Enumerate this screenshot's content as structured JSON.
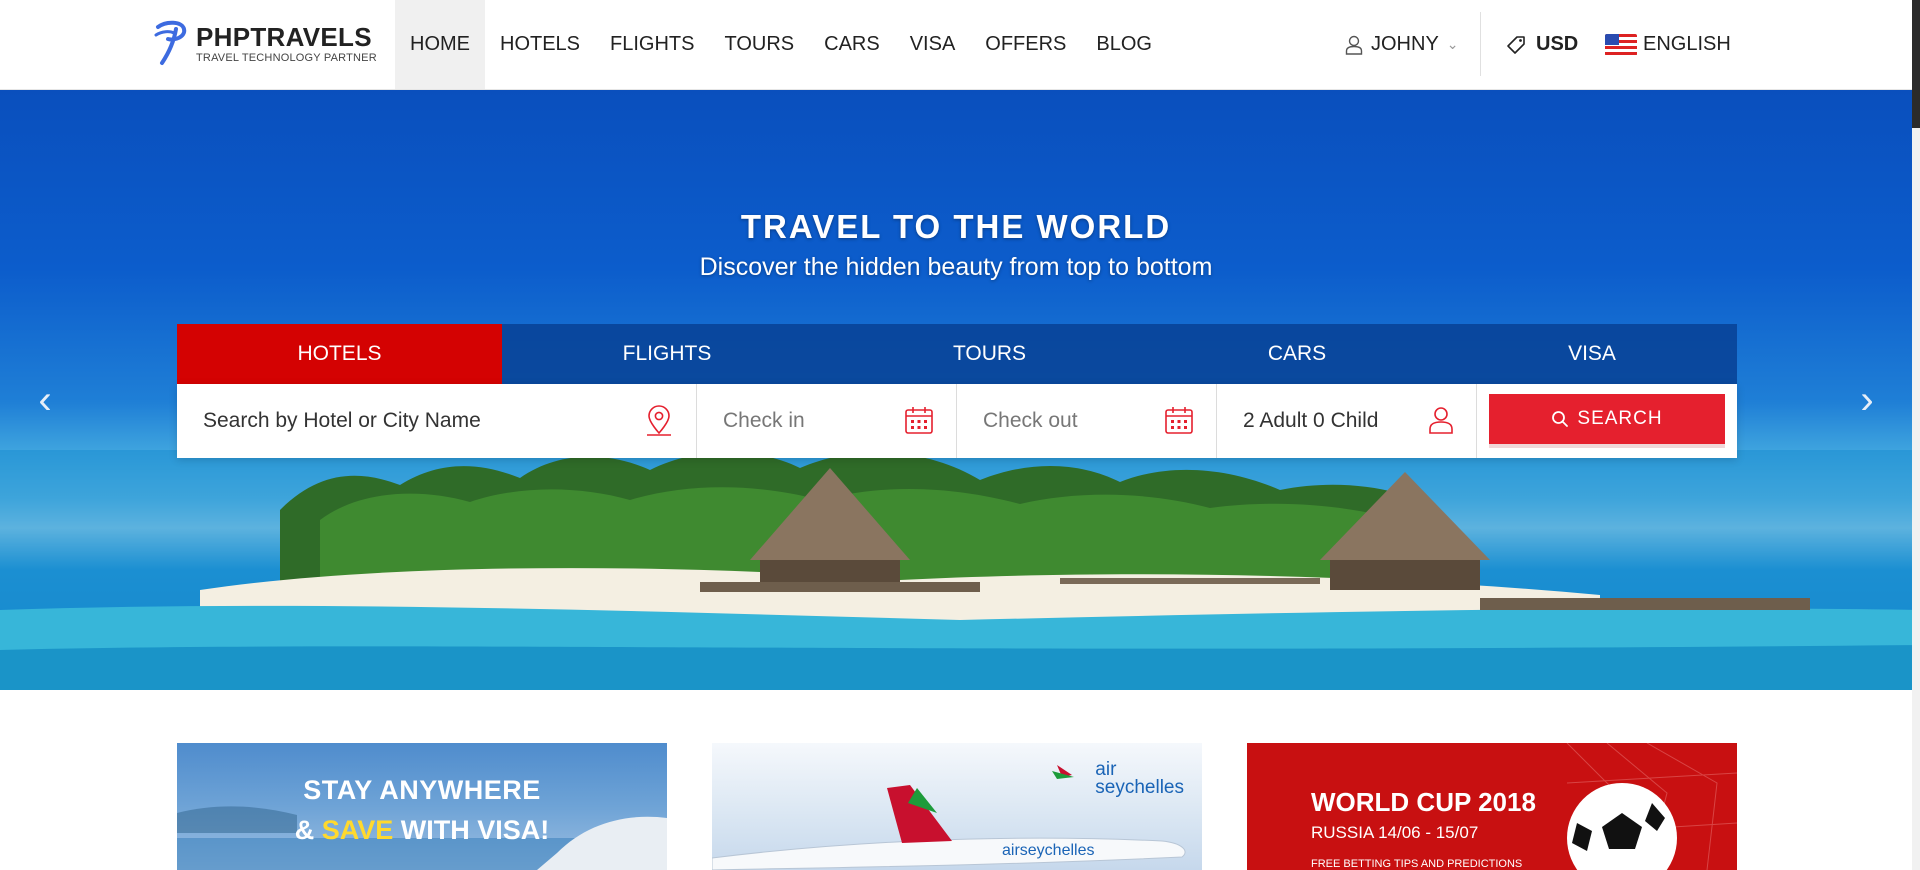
{
  "logo": {
    "name": "PHPTRAVELS",
    "tagline": "TRAVEL TECHNOLOGY PARTNER"
  },
  "nav": [
    "HOME",
    "HOTELS",
    "FLIGHTS",
    "TOURS",
    "CARS",
    "VISA",
    "OFFERS",
    "BLOG"
  ],
  "header": {
    "user": "JOHNY",
    "currency": "USD",
    "language": "ENGLISH"
  },
  "hero": {
    "title": "TRAVEL TO THE WORLD",
    "subtitle": "Discover the hidden beauty from top to bottom"
  },
  "search_tabs": [
    "HOTELS",
    "FLIGHTS",
    "TOURS",
    "CARS",
    "VISA"
  ],
  "search": {
    "location_placeholder": "Search by Hotel or City Name",
    "checkin_placeholder": "Check in",
    "checkout_placeholder": "Check out",
    "guests": "2 Adult 0 Child",
    "button": "SEARCH"
  },
  "promos": {
    "visa": {
      "line1": "STAY ANYWHERE",
      "amp": "& ",
      "highlight": "SAVE",
      "rest": " WITH VISA!"
    },
    "air": {
      "brand_line1": "air",
      "brand_line2": "seychelles"
    },
    "worldcup": {
      "title": "WORLD CUP 2018",
      "dates": "RUSSIA 14/06 - 15/07",
      "tips": "FREE BETTING TIPS AND PREDICTIONS"
    }
  },
  "colors": {
    "accent_red": "#d40202",
    "button_red": "#e5202e",
    "tab_blue": "#084296",
    "logo_blue": "#3d6be0"
  }
}
